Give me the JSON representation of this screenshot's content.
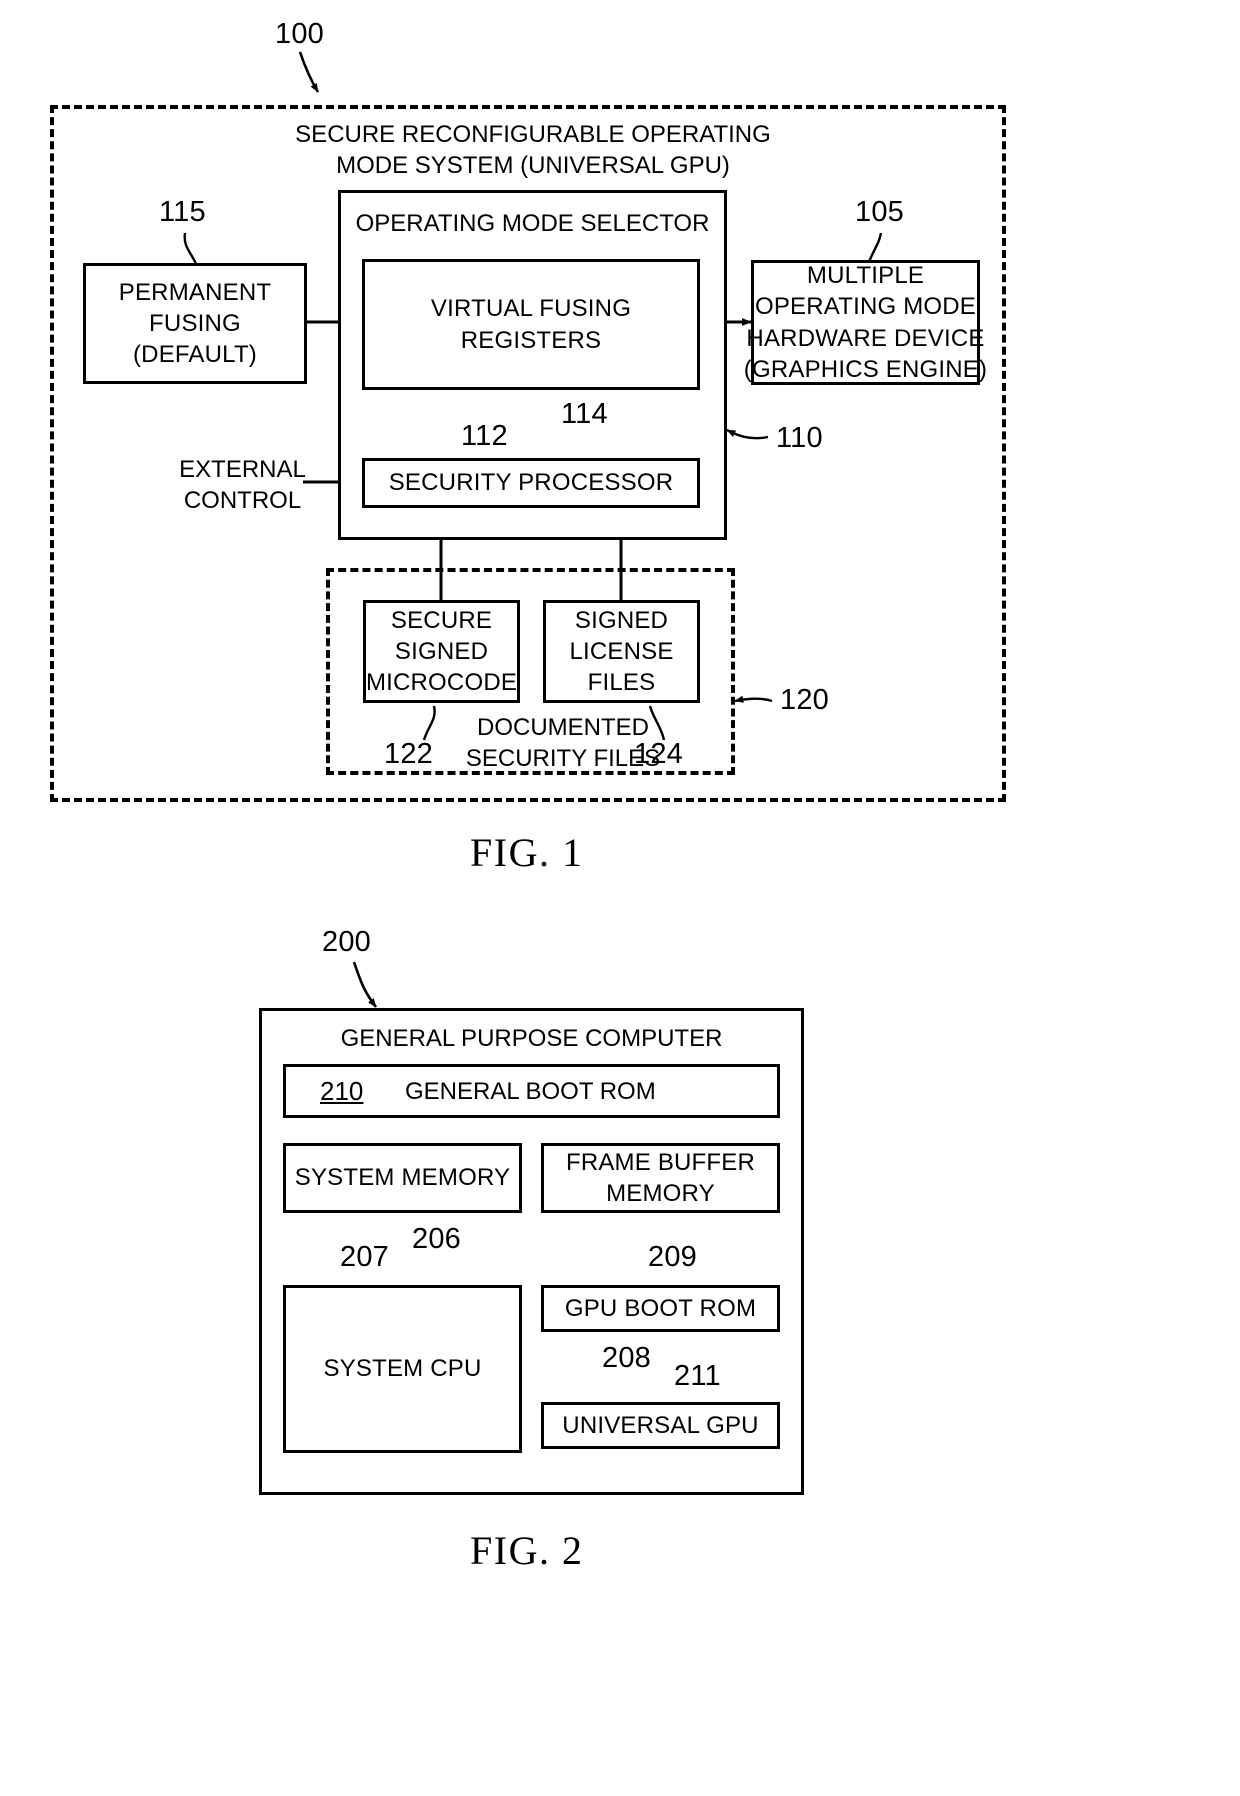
{
  "figures": [
    {
      "id": "fig1",
      "caption": "FIG. 1",
      "ref": "100",
      "outer_title_line1": "SECURE RECONFIGURABLE OPERATING",
      "outer_title_line2": "MODE SYSTEM (UNIVERSAL GPU)",
      "blocks": {
        "permanent_fusing": "PERMANENT\nFUSING\n(DEFAULT)",
        "operating_mode_selector": "OPERATING MODE SELECTOR",
        "virtual_fusing_registers": "VIRTUAL FUSING REGISTERS",
        "multiple_operating_mode_hw": "MULTIPLE\nOPERATING MODE\nHARDWARE DEVICE\n(GRAPHICS ENGINE)",
        "security_processor": "SECURITY PROCESSOR",
        "secure_signed_microcode": "SECURE\nSIGNED\nMICROCODE",
        "signed_license_files": "SIGNED\nLICENSE\nFILES",
        "documented_security_files_l1": "DOCUMENTED",
        "documented_security_files_l2": "SECURITY FILES"
      },
      "labels": {
        "external_control": "EXTERNAL\nCONTROL"
      },
      "refs": {
        "r100": "100",
        "r115": "115",
        "r105": "105",
        "r110": "110",
        "r112": "112",
        "r114": "114",
        "r120": "120",
        "r122": "122",
        "r124": "124"
      }
    },
    {
      "id": "fig2",
      "caption": "FIG. 2",
      "ref": "200",
      "outer_title": "GENERAL PURPOSE COMPUTER",
      "blocks": {
        "general_boot_rom_ref": "210",
        "general_boot_rom": "GENERAL BOOT ROM",
        "system_memory": "SYSTEM MEMORY",
        "frame_buffer_memory": "FRAME BUFFER\nMEMORY",
        "system_cpu": "SYSTEM CPU",
        "gpu_boot_rom": "GPU BOOT ROM",
        "universal_gpu": "UNIVERSAL GPU"
      },
      "refs": {
        "r200": "200",
        "r206": "206",
        "r207": "207",
        "r208": "208",
        "r209": "209",
        "r211": "211"
      }
    }
  ]
}
